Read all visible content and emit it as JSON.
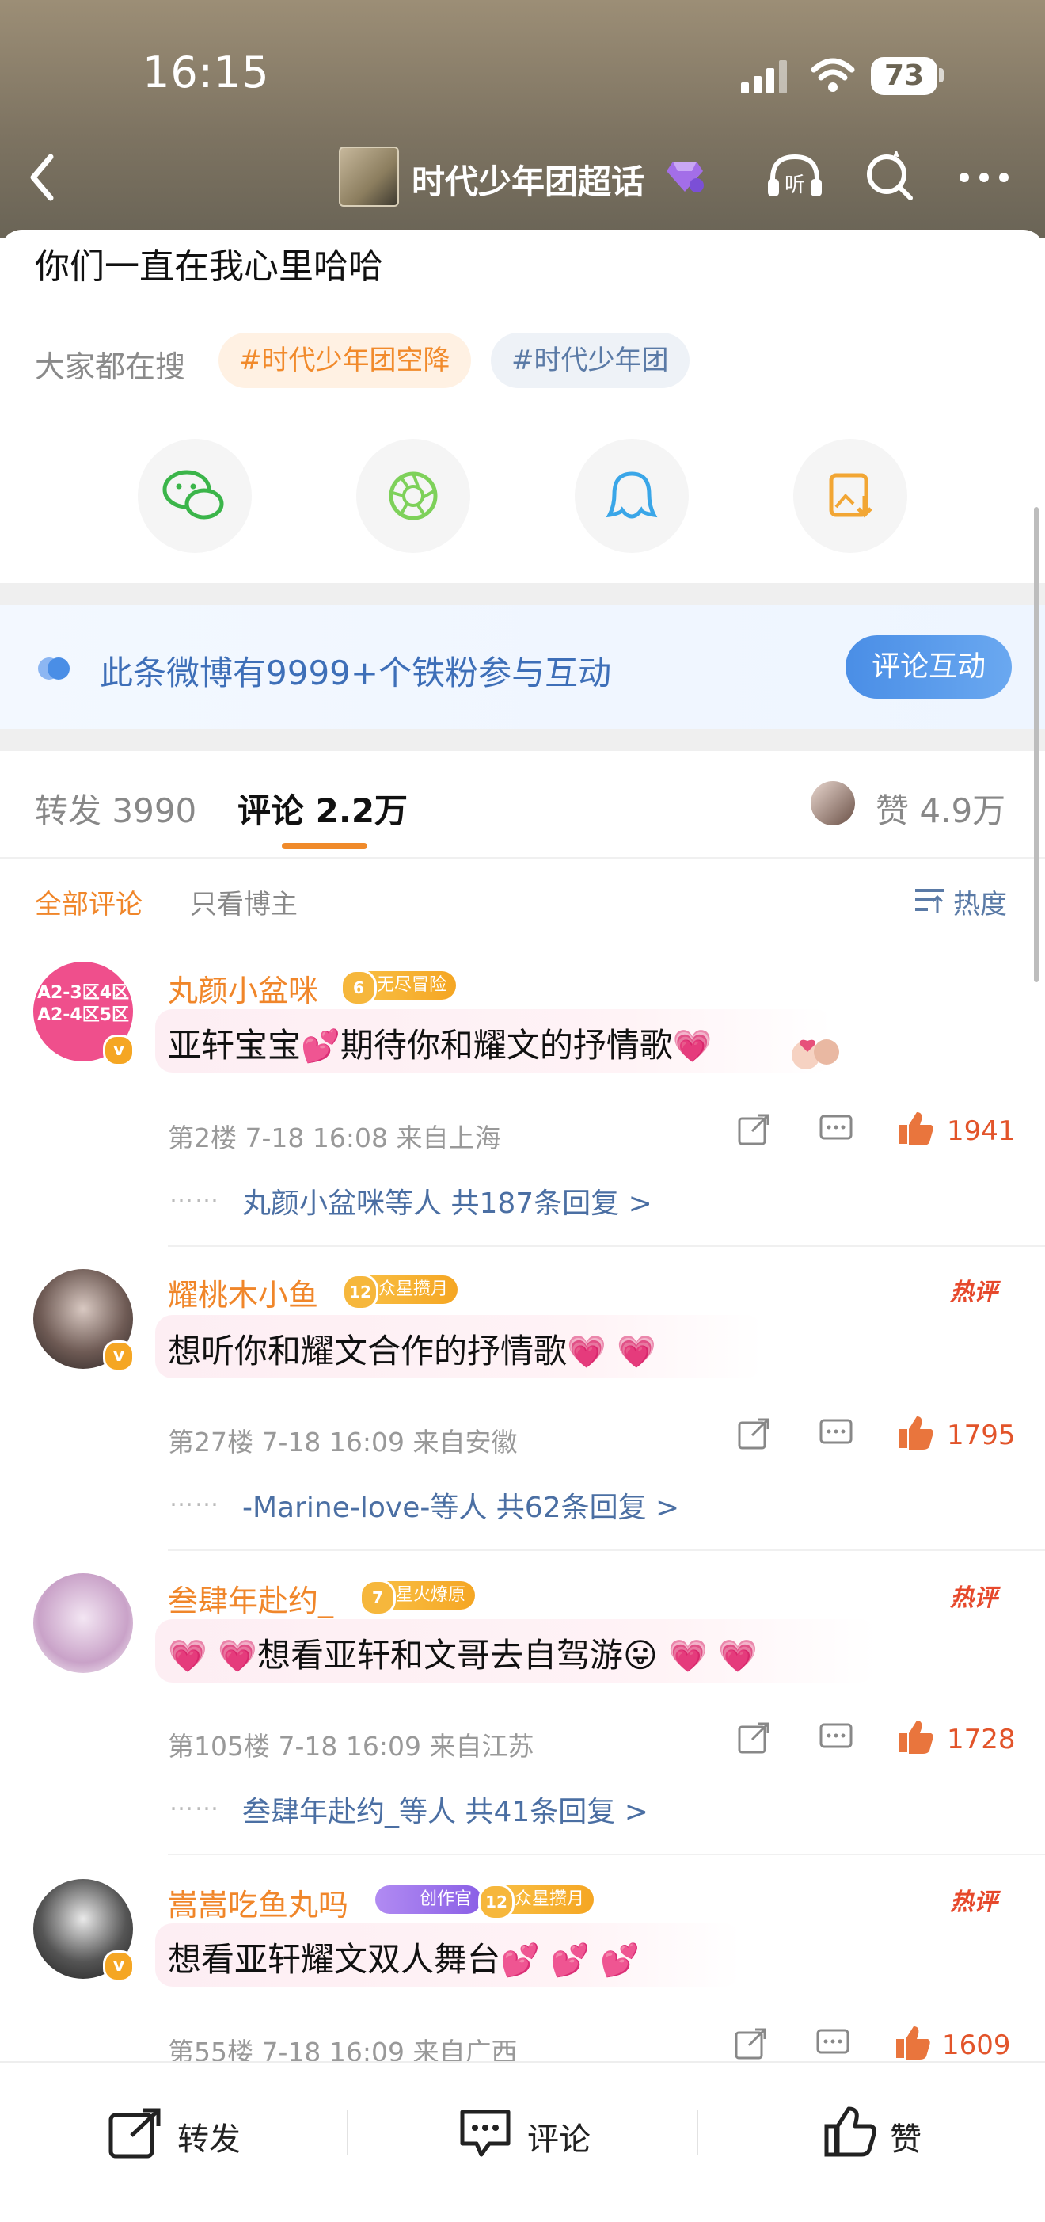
{
  "status": {
    "time": "16:15",
    "battery": "73"
  },
  "nav": {
    "title": "时代少年团超话"
  },
  "post": {
    "text": "你们一直在我心里哈哈"
  },
  "search": {
    "label": "大家都在搜",
    "tags": [
      "#时代少年团空降",
      "#时代少年团"
    ]
  },
  "share": {
    "items": [
      "wechat-icon",
      "moments-icon",
      "qq-icon",
      "save-image-icon"
    ]
  },
  "banner": {
    "text": "此条微博有9999+个铁粉参与互动",
    "button": "评论互动"
  },
  "tabs": {
    "repost_label": "转发",
    "repost_count": "3990",
    "comment_label": "评论",
    "comment_count": "2.2万",
    "like_label": "赞",
    "like_count": "4.9万"
  },
  "filters": {
    "all": "全部评论",
    "author_only": "只看博主",
    "sort": "热度"
  },
  "comments": [
    {
      "user": "丸颜小盆咪",
      "level": "6",
      "badge": "无尽冒险",
      "text": "亚轩宝宝",
      "text2": "期待你和耀文的抒情歌",
      "meta": "第2楼 7-18 16:08 来自上海",
      "likes": "1941",
      "reply_user": "丸颜小盆咪等人",
      "reply_count": "共187条回复 >",
      "avatar_text": "A2-3区4区 A2-4区5区",
      "hot": ""
    },
    {
      "user": "耀桃木小鱼",
      "level": "12",
      "badge": "众星攒月",
      "text": "想听你和耀文合作的抒情歌",
      "meta": "第27楼 7-18 16:09 来自安徽",
      "likes": "1795",
      "reply_user": "-Marine-love-等人",
      "reply_count": "共62条回复 >",
      "hot": "热评"
    },
    {
      "user": "叁肆年赴约_",
      "level": "7",
      "badge": "星火燎原",
      "text": "想看亚轩和文哥去自驾游",
      "meta": "第105楼 7-18 16:09 来自江苏",
      "likes": "1728",
      "reply_user": "叁肆年赴约_等人",
      "reply_count": "共41条回复 >",
      "hot": "热评"
    },
    {
      "user": "嵩嵩吃鱼丸吗",
      "level": "12",
      "badge": "众星攒月",
      "badge2": "创作官",
      "text": "想看亚轩耀文双人舞台",
      "meta": "第55楼 7-18 16:09 来自广西",
      "likes": "1609",
      "hot": "热评"
    }
  ],
  "bottom": {
    "repost": "转发",
    "comment": "评论",
    "like": "赞"
  },
  "colors": {
    "accent": "#f08a2a",
    "link": "#4b6fa3",
    "like": "#e2542a",
    "banner": "#3e6fb8"
  }
}
